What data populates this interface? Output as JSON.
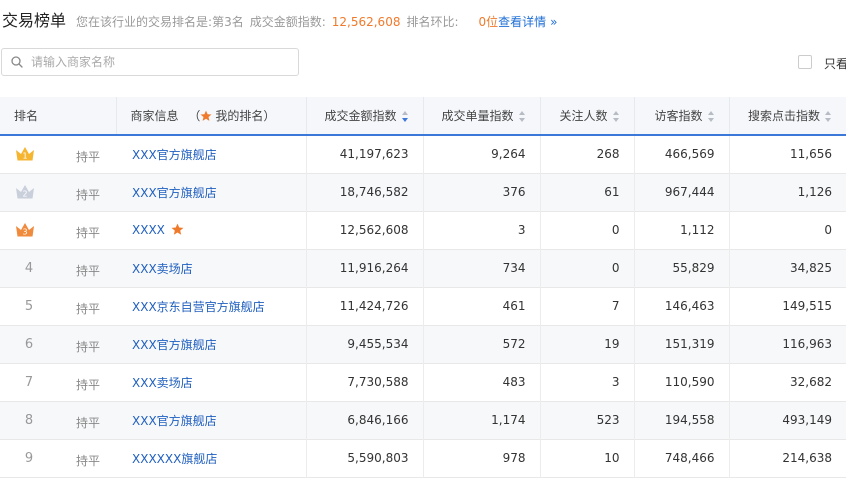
{
  "header": {
    "title": "交易榜单",
    "rank_prefix": "您在该行业的交易排名是:",
    "rank_value": "第3名",
    "index_label": "成交金额指数:",
    "index_value": "12,562,608",
    "change_label": "排名环比:",
    "change_value": "0位",
    "detail_link": "查看详情",
    "detail_chevron": "»"
  },
  "search": {
    "placeholder": "请输入商家名称"
  },
  "filter": {
    "only_label": "只看"
  },
  "table": {
    "columns": {
      "rank": "排名",
      "merchant": "商家信息",
      "merchant_hint_open": "（",
      "merchant_hint": "我的排名",
      "merchant_hint_close": "）",
      "gmv": "成交金额指数",
      "orders": "成交单量指数",
      "followers": "关注人数",
      "visitors": "访客指数",
      "search_clicks": "搜索点击指数"
    },
    "rows": [
      {
        "rank": "1",
        "change": "持平",
        "merchant": "XXX官方旗舰店",
        "gmv": "41,197,623",
        "orders": "9,264",
        "followers": "268",
        "visitors": "466,569",
        "search_clicks": "11,656"
      },
      {
        "rank": "2",
        "change": "持平",
        "merchant": "XXX官方旗舰店",
        "gmv": "18,746,582",
        "orders": "376",
        "followers": "61",
        "visitors": "967,444",
        "search_clicks": "1,126"
      },
      {
        "rank": "3",
        "change": "持平",
        "merchant": "XXXX",
        "gmv": "12,562,608",
        "orders": "3",
        "followers": "0",
        "visitors": "1,112",
        "search_clicks": "0"
      },
      {
        "rank": "4",
        "change": "持平",
        "merchant": "XXX卖场店",
        "gmv": "11,916,264",
        "orders": "734",
        "followers": "0",
        "visitors": "55,829",
        "search_clicks": "34,825"
      },
      {
        "rank": "5",
        "change": "持平",
        "merchant": "XXX京东自营官方旗舰店",
        "gmv": "11,424,726",
        "orders": "461",
        "followers": "7",
        "visitors": "146,463",
        "search_clicks": "149,515"
      },
      {
        "rank": "6",
        "change": "持平",
        "merchant": "XXX官方旗舰店",
        "gmv": "9,455,534",
        "orders": "572",
        "followers": "19",
        "visitors": "151,319",
        "search_clicks": "116,963"
      },
      {
        "rank": "7",
        "change": "持平",
        "merchant": "XXX卖场店",
        "gmv": "7,730,588",
        "orders": "483",
        "followers": "3",
        "visitors": "110,590",
        "search_clicks": "32,682"
      },
      {
        "rank": "8",
        "change": "持平",
        "merchant": "XXX官方旗舰店",
        "gmv": "6,846,166",
        "orders": "1,174",
        "followers": "523",
        "visitors": "194,558",
        "search_clicks": "493,149"
      },
      {
        "rank": "9",
        "change": "持平",
        "merchant": "XXXXXX旗舰店",
        "gmv": "5,590,803",
        "orders": "978",
        "followers": "10",
        "visitors": "748,466",
        "search_clicks": "214,638"
      }
    ]
  },
  "icons": {
    "search": "search-icon",
    "my_rank_star": "star-icon",
    "crowns": [
      "gold-crown-icon",
      "silver-crown-icon",
      "bronze-crown-icon"
    ],
    "sort": "sort-icon"
  },
  "colors": {
    "accent": "#3c78d8",
    "link": "#1f5fbf",
    "highlight": "#f07a2b",
    "gold": "#f6b531",
    "silver": "#c9cfdb",
    "bronze": "#f08a3c"
  }
}
